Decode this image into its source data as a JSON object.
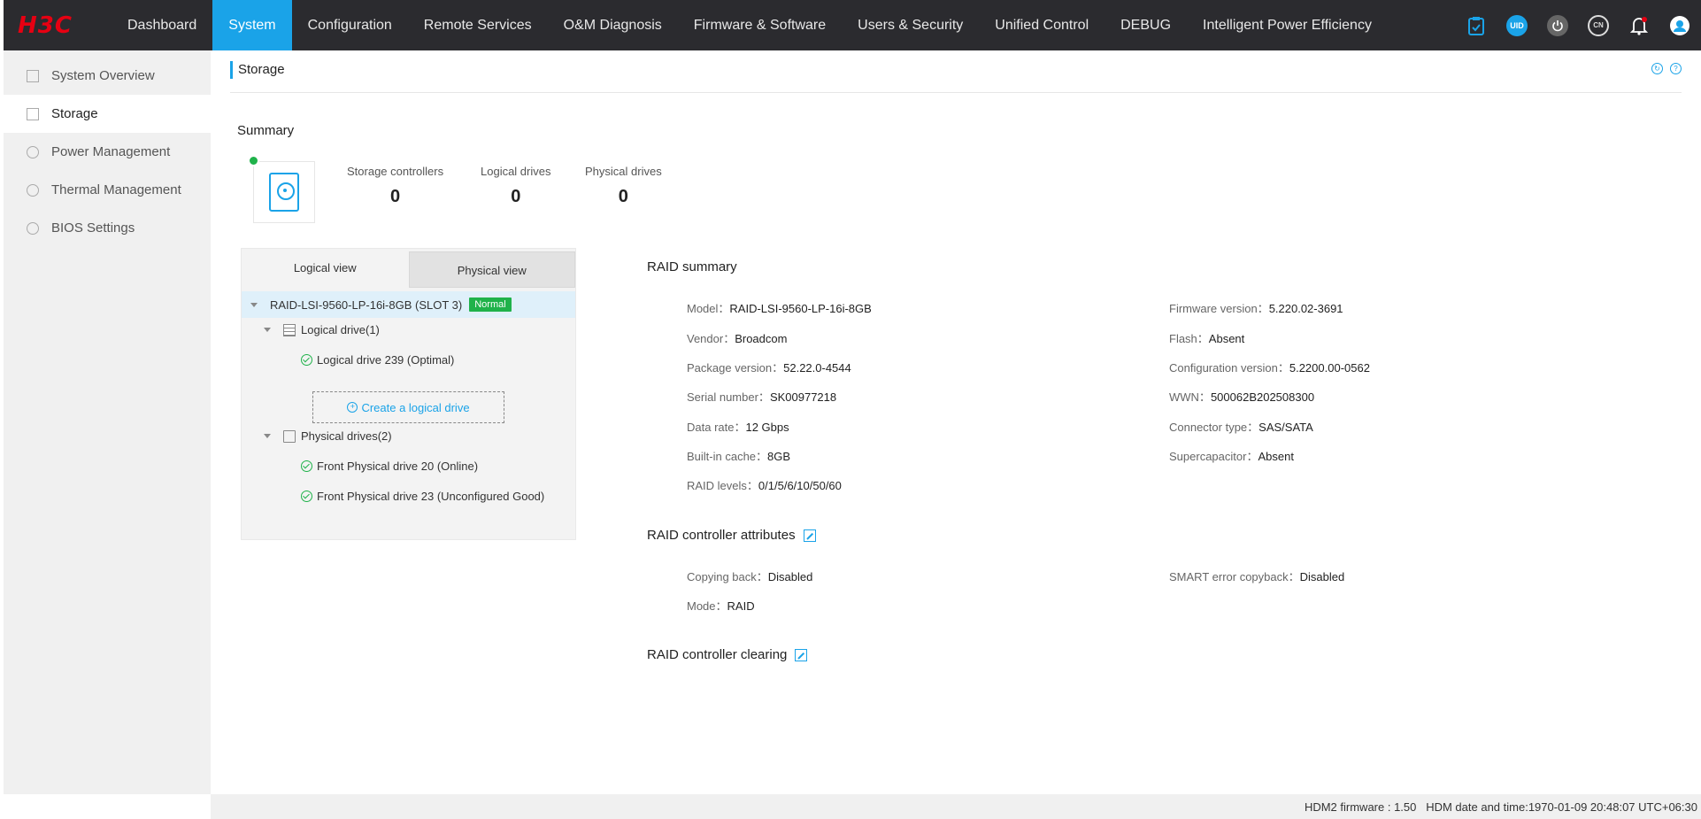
{
  "brand": {
    "logo": "H3C",
    "color": "#e60012"
  },
  "nav": {
    "items": [
      "Dashboard",
      "System",
      "Configuration",
      "Remote Services",
      "O&M Diagnosis",
      "Firmware & Software",
      "Users & Security",
      "Unified Control",
      "DEBUG",
      "Intelligent Power Efficiency"
    ],
    "active": "System",
    "accent": "#1aa3e8",
    "icons": {
      "uid": "UID",
      "lang": "CN"
    }
  },
  "sidebar": {
    "items": [
      {
        "label": "System Overview",
        "icon": "document-icon"
      },
      {
        "label": "Storage",
        "icon": "storage-icon"
      },
      {
        "label": "Power Management",
        "icon": "power-icon"
      },
      {
        "label": "Thermal Management",
        "icon": "fan-icon"
      },
      {
        "label": "BIOS Settings",
        "icon": "settings-icon"
      }
    ],
    "active": "Storage"
  },
  "page": {
    "title": "Storage"
  },
  "summary": {
    "label": "Summary",
    "stats": [
      {
        "label": "Storage controllers",
        "value": "0"
      },
      {
        "label": "Logical drives",
        "value": "0"
      },
      {
        "label": "Physical drives",
        "value": "0"
      }
    ]
  },
  "tree": {
    "tabs": [
      "Logical view",
      "Physical view"
    ],
    "controller": "RAID-LSI-9560-LP-16i-8GB (SLOT 3)",
    "controller_status": "Normal",
    "logical_group": "Logical drive(1)",
    "logical_items": [
      "Logical drive 239 (Optimal)"
    ],
    "create_label": "Create a logical drive",
    "physical_group": "Physical drives(2)",
    "physical_items": [
      "Front Physical drive 20 (Online)",
      "Front Physical drive 23 (Unconfigured Good)"
    ]
  },
  "raid_summary": {
    "title": "RAID summary",
    "left": [
      {
        "k": "Model：",
        "v": "RAID-LSI-9560-LP-16i-8GB"
      },
      {
        "k": "Vendor：",
        "v": "Broadcom"
      },
      {
        "k": "Package version：",
        "v": "52.22.0-4544"
      },
      {
        "k": "Serial number：",
        "v": "SK00977218"
      },
      {
        "k": "Data rate：",
        "v": "12 Gbps"
      },
      {
        "k": "Built-in cache：",
        "v": "8GB"
      },
      {
        "k": "RAID levels：",
        "v": "0/1/5/6/10/50/60"
      }
    ],
    "right": [
      {
        "k": "Firmware version：",
        "v": "5.220.02-3691"
      },
      {
        "k": "Flash：",
        "v": "Absent"
      },
      {
        "k": "Configuration version：",
        "v": "5.2200.00-0562"
      },
      {
        "k": "WWN：",
        "v": "500062B202508300"
      },
      {
        "k": "Connector type：",
        "v": "SAS/SATA"
      },
      {
        "k": "Supercapacitor：",
        "v": "Absent"
      }
    ]
  },
  "raid_attributes": {
    "title": "RAID controller attributes",
    "left": [
      {
        "k": "Copying back：",
        "v": "Disabled"
      },
      {
        "k": "Mode：",
        "v": "RAID"
      }
    ],
    "right": [
      {
        "k": "SMART error copyback：",
        "v": "Disabled"
      }
    ]
  },
  "raid_clearing": {
    "title": "RAID controller clearing"
  },
  "footer": {
    "firmware": "HDM2 firmware : 1.50",
    "datetime": "HDM date and time:1970-01-09 20:48:07 UTC+06:30"
  }
}
